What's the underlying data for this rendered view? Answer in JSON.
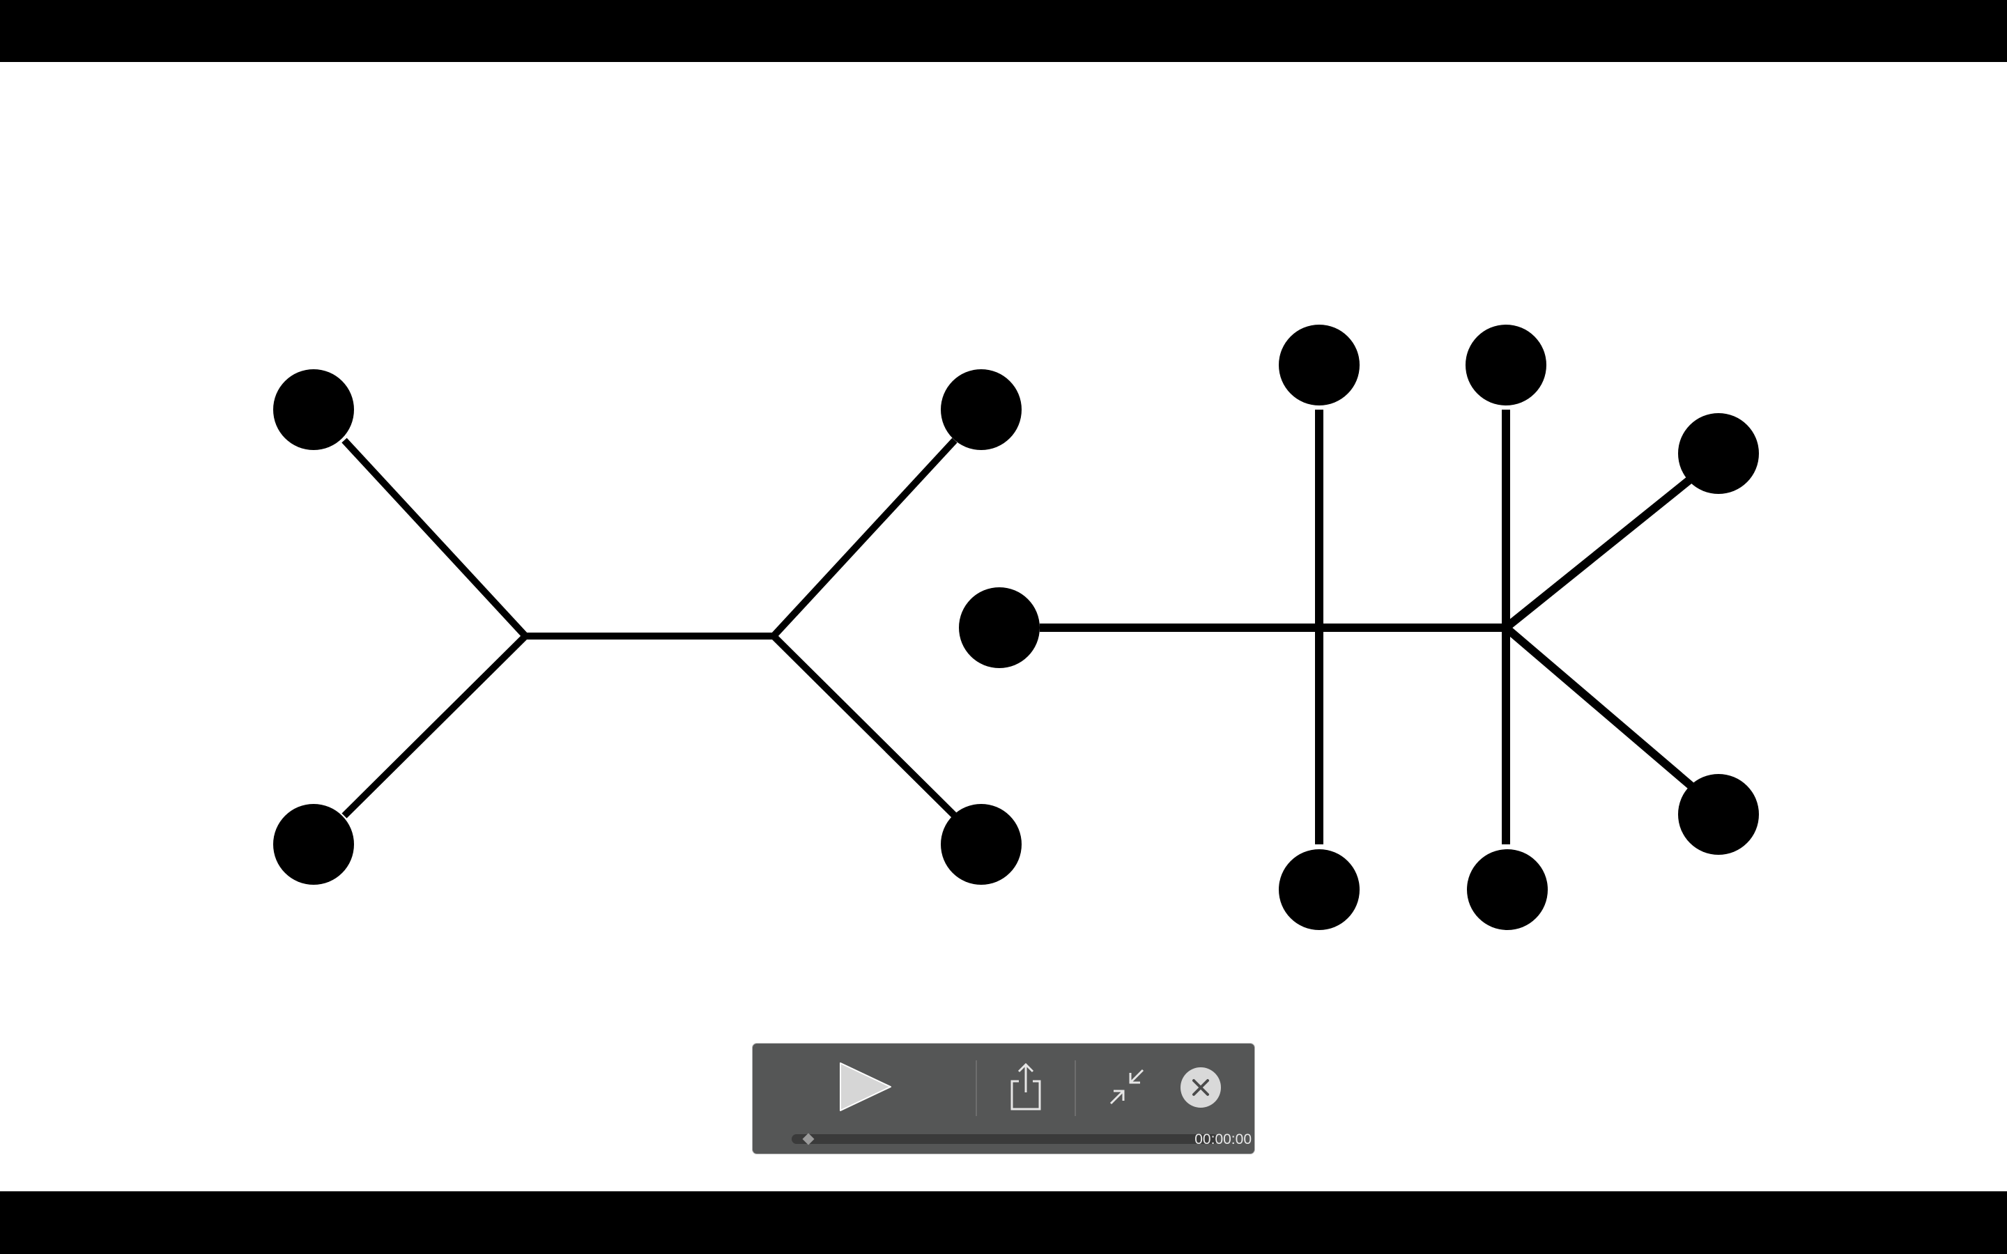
{
  "player": {
    "letterbox_color": "#000000",
    "frame_background": "#ffffff",
    "graph_color": "#000000"
  },
  "graphs": [
    {
      "name": "left-tree",
      "node_count": 4
    },
    {
      "name": "right-tree",
      "node_count": 7
    }
  ],
  "controls": {
    "background": "#555656",
    "play_icon": "play-icon",
    "share_icon": "share-icon",
    "exit_fullscreen_icon": "exit-fullscreen-icon",
    "close_icon": "close-icon",
    "progress": 0,
    "timecode": "00:00:00"
  }
}
